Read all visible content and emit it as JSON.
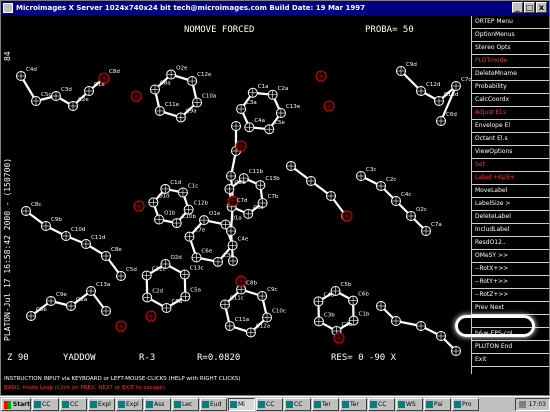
{
  "window": {
    "title": "Microimages X Server  1024x740x24 bit  tech@microimages.com  Build Date: 19 Mar 1997",
    "min": "_",
    "max": "□",
    "close": "x"
  },
  "canvas": {
    "header_mode": "NOMOVE FORCED",
    "header_proba": "PROBA=   50",
    "top_left_num": "84",
    "side_text": "PLATON-Jul 17 16:58:42 2000 - (150700)",
    "footer_z": "Z 90",
    "footer_yaddow": "YADDOW",
    "footer_r3": "R-3",
    "footer_r": "R=0.0820",
    "footer_res": "RES=    0   -90 X",
    "atom_labels": [
      "C10a",
      "C9a",
      "C11e",
      "C8a",
      "O2e",
      "C12e",
      "C13e",
      "C5e",
      "C4a",
      "C3a",
      "C1a",
      "C2a",
      "C4e",
      "C3e",
      "C6e",
      "C7e",
      "O1e",
      "O1a",
      "C5a",
      "C6a",
      "C2d",
      "C12c",
      "O2d",
      "C13c",
      "C10c",
      "C12a",
      "C11a",
      "C11c",
      "C8b",
      "C9c",
      "C1b",
      "C2b",
      "C3b",
      "C4b",
      "C5b",
      "C6b",
      "C7b",
      "C6c",
      "C7d",
      "O2b",
      "C11b",
      "C13b",
      "C12b",
      "C10b",
      "O1b",
      "O1d",
      "C1d",
      "C1c",
      "C4d",
      "C5c",
      "C3d",
      "C2e",
      "C1e",
      "C8d",
      "C9d",
      "C12d",
      "C13d",
      "C7c",
      "C6d",
      "C8c",
      "C9b",
      "C10d",
      "C11d",
      "C8e",
      "C5d",
      "C3c",
      "C2c",
      "C4c",
      "O2c",
      "C7a",
      "C8e",
      "C9e",
      "O2a",
      "C13a"
    ]
  },
  "menu": [
    {
      "label": "ORTEP Menu",
      "red": false
    },
    {
      "label": "OptionMenus",
      "red": false
    },
    {
      "label": "Stereo Opts",
      "red": false
    },
    {
      "label": "PLOTmode",
      "red": true
    },
    {
      "label": "DeleteMname",
      "red": false
    },
    {
      "label": "Probability",
      "red": false
    },
    {
      "label": "CalcCoordx",
      "red": false
    },
    {
      "label": "Adjust El.s",
      "red": true
    },
    {
      "label": "Envelope El",
      "red": false
    },
    {
      "label": "Octant El.s",
      "red": false
    },
    {
      "label": "ViewOptions",
      "red": false
    },
    {
      "label": "Set",
      "red": true
    },
    {
      "label": "Label +Kp5+",
      "red": true
    },
    {
      "label": "MoveLabel",
      "red": false
    },
    {
      "label": "LabelSize >",
      "red": false
    },
    {
      "label": "DeleteLabel",
      "red": false
    },
    {
      "label": "IncludLabel",
      "red": false
    },
    {
      "label": "ResdO12..",
      "red": false
    },
    {
      "label": "OMeSY >>",
      "red": false
    },
    {
      "label": "--RotX+>>",
      "red": false
    },
    {
      "label": "--RotY+>>",
      "red": false
    },
    {
      "label": "--RotZ+>>",
      "red": false
    },
    {
      "label": "Prev    Next",
      "red": false
    },
    {
      "label": "",
      "red": false
    },
    {
      "label": "b&w-EPS-col",
      "red": false
    },
    {
      "label": "PLUTON  End",
      "red": false
    },
    {
      "label": "  Exit",
      "red": false
    }
  ],
  "status": {
    "line1": "INSTRUCTION INPUT via KEYBOARD or LEFT-MOUSE-CLICKS (HELP with RIGHT CLICKS)",
    "line2": "BASIC-mode Loop (Click on PREV, NEXT or EXIT to escape)"
  },
  "taskbar": {
    "start": "Start",
    "tasks": [
      "CC",
      "CC",
      "Expl",
      "Expl",
      "Ass",
      "Lec",
      "Eud",
      "Mi",
      "CC",
      "CC",
      "Ter",
      "Ter",
      "CC",
      "WS",
      "Pai",
      "Pro"
    ],
    "active_index": 7,
    "clock": "17:03"
  },
  "colors": {
    "oxygen": "#e00000",
    "carbon": "#ffffff",
    "bond": "#ffffff",
    "ring": "#ffffff",
    "highlight": "#ffffff"
  }
}
